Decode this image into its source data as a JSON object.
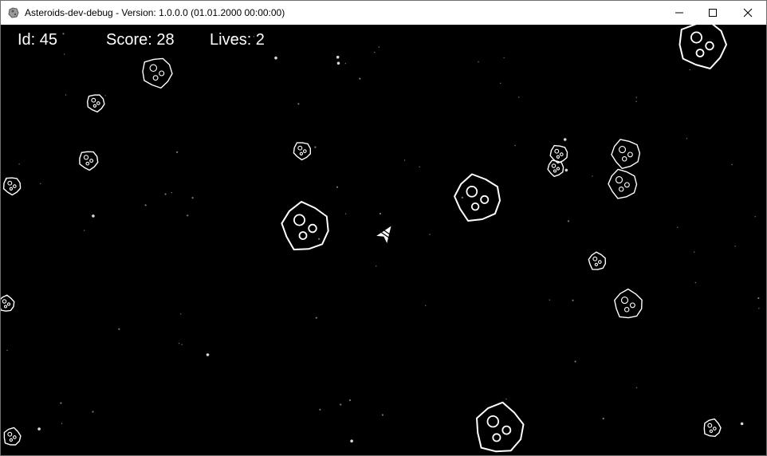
{
  "window": {
    "title": "Asteroids-dev-debug - Version: 1.0.0.0 (01.01.2000 00:00:00)",
    "controls": {
      "minimize": "minimize-icon",
      "maximize": "maximize-icon",
      "close": "close-icon"
    }
  },
  "hud": {
    "id": "Id: 45",
    "score": "Score: 28",
    "lives": "Lives: 2"
  },
  "colors": {
    "background": "#000000",
    "foreground": "#ffffff",
    "titlebar": "#ffffff"
  },
  "icons": {
    "app": "asteroid-app-icon",
    "ship": "player-ship",
    "asteroid": "asteroid-outline"
  }
}
